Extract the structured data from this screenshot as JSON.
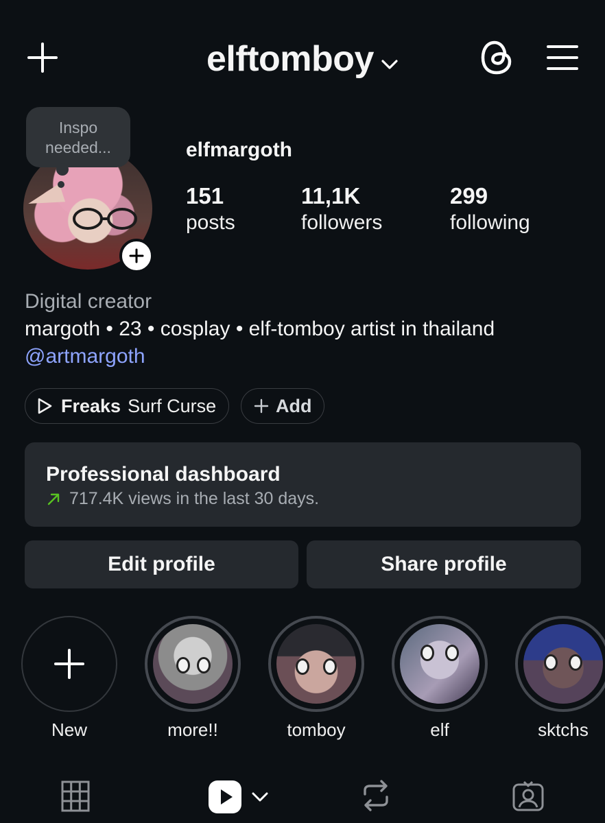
{
  "header": {
    "username": "elftomboy",
    "icons": [
      "plus-icon",
      "chevron-down-icon",
      "threads-icon",
      "menu-icon"
    ]
  },
  "profile": {
    "note": "Inspo needed...",
    "display_name": "elfmargoth",
    "stats": {
      "posts": {
        "value": "151",
        "label": "posts"
      },
      "followers": {
        "value": "11,1K",
        "label": "followers"
      },
      "following": {
        "value": "299",
        "label": "following"
      }
    }
  },
  "bio": {
    "category": "Digital creator",
    "text": "margoth • 23 • cosplay • elf-tomboy artist in thailand",
    "link": "@artmargoth"
  },
  "chips": {
    "music_song": "Freaks",
    "music_artist": "Surf Curse",
    "add_label": "Add"
  },
  "dashboard": {
    "title": "Professional dashboard",
    "subtitle": "717.4K views in the last 30 days."
  },
  "actions": {
    "edit": "Edit profile",
    "share": "Share profile"
  },
  "highlights": [
    {
      "label": "New"
    },
    {
      "label": "more!!"
    },
    {
      "label": "tomboy"
    },
    {
      "label": "elf"
    },
    {
      "label": "sktchs"
    }
  ],
  "tabs": [
    "grid-icon",
    "reels-icon",
    "reposts-icon",
    "tagged-icon"
  ],
  "colors": {
    "background": "#0c1014",
    "card": "#25292e",
    "link": "#8ea4ff",
    "trend_up": "#58c322",
    "muted_text": "#a8adb3"
  }
}
